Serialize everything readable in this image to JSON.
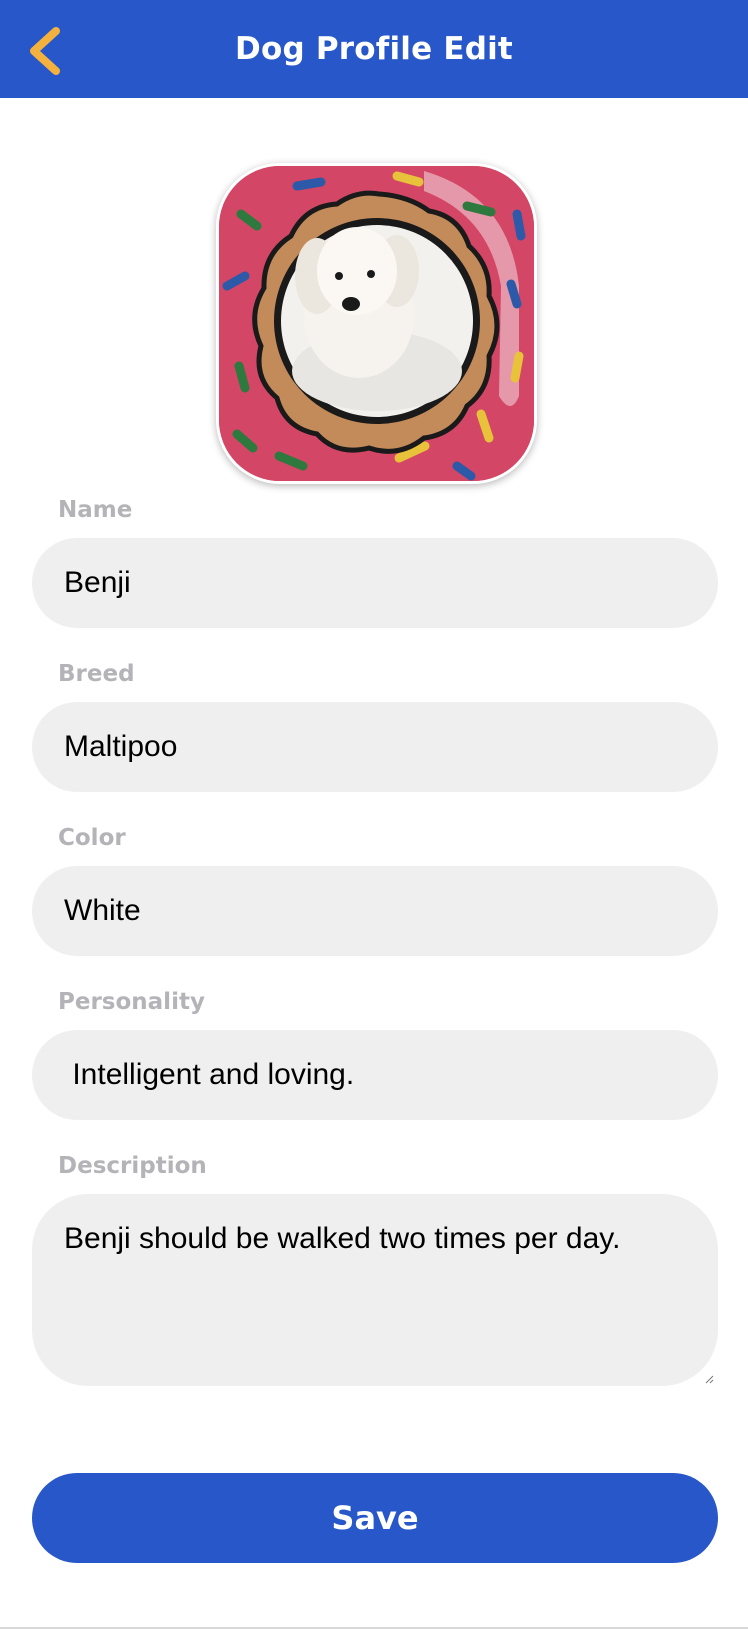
{
  "header": {
    "title": "Dog Profile Edit",
    "back_icon": "chevron-left-icon",
    "background_color": "#2757c8",
    "back_icon_color": "#f4b13e"
  },
  "profile_photo": {
    "subject": "dog-photo"
  },
  "form": {
    "name": {
      "label": "Name",
      "value": "Benji"
    },
    "breed": {
      "label": "Breed",
      "value": "Maltipoo"
    },
    "color": {
      "label": "Color",
      "value": "White"
    },
    "personality": {
      "label": "Personality",
      "value": " Intelligent and loving."
    },
    "description": {
      "label": "Description",
      "value": "Benji should be walked two times per day."
    }
  },
  "save_label": "Save",
  "accent_color": "#2757c8",
  "label_color": "#b4b4b8",
  "input_background": "#efefef"
}
